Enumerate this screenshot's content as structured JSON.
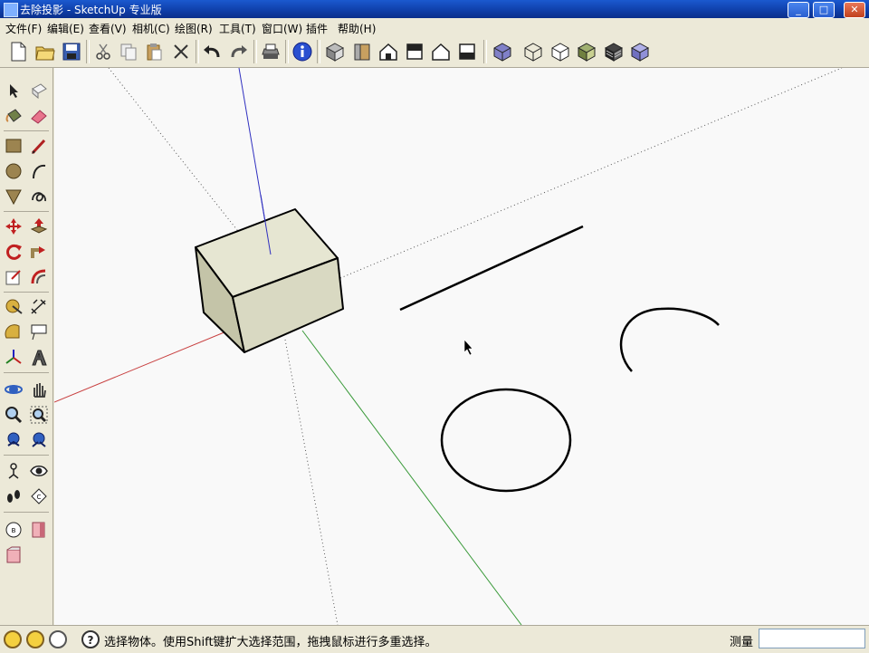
{
  "window": {
    "title": "去除投影 - SketchUp 专业版",
    "minimize_glyph": "_",
    "maximize_glyph": "□",
    "close_glyph": "✕"
  },
  "menu": [
    {
      "label": "文件(F)"
    },
    {
      "label": "编辑(E)"
    },
    {
      "label": "查看(V)"
    },
    {
      "label": "相机(C)"
    },
    {
      "label": "绘图(R)"
    },
    {
      "label": "工具(T)"
    },
    {
      "label": "窗口(W)"
    },
    {
      "label": "插件"
    },
    {
      "label": "帮助(H)"
    }
  ],
  "toolbar": {
    "icons": [
      "new-file-icon",
      "open-folder-icon",
      "save-icon",
      "cut-icon",
      "copy-icon",
      "paste-icon",
      "erase-icon",
      "undo-icon",
      "redo-icon",
      "print-icon",
      "model-info-icon",
      "iso-view-icon",
      "top-view-icon",
      "front-view-icon",
      "right-view-icon",
      "back-view-icon",
      "left-view-icon",
      "xray-style-icon",
      "wireframe-style-icon",
      "hidden-line-style-icon",
      "shaded-style-icon",
      "shaded-texture-style-icon",
      "monochrome-style-icon"
    ]
  },
  "left_tools": [
    "select-icon",
    "make-component-icon",
    "paint-bucket-icon",
    "eraser-icon",
    "rectangle-icon",
    "line-icon",
    "circle-icon",
    "arc-icon",
    "polygon-icon",
    "freehand-icon",
    "move-icon",
    "push-pull-icon",
    "rotate-icon",
    "follow-me-icon",
    "scale-icon",
    "offset-icon",
    "tape-measure-icon",
    "dimension-icon",
    "protractor-icon",
    "text-icon",
    "axes-icon",
    "3d-text-icon",
    "orbit-icon",
    "pan-icon",
    "zoom-icon",
    "zoom-window-icon",
    "previous-view-icon",
    "zoom-extents-icon",
    "position-camera-icon",
    "look-around-icon",
    "walk-icon",
    "section-plane-icon",
    "add-location-icon",
    "toggle-terrain-icon",
    "photo-texture-icon"
  ],
  "status": {
    "hint": "选择物体。使用Shift键扩大选择范围，拖拽鼠标进行多重选择。",
    "measurements_label": "测量",
    "measurements_value": "",
    "help_glyph": "?"
  },
  "colors": {
    "axis_red": "#c84040",
    "axis_green": "#3a9a3a",
    "axis_blue": "#3030c0",
    "box_top": "#e6e6d2",
    "box_front": "#d9d9c2",
    "box_side": "#c4c4a8"
  }
}
